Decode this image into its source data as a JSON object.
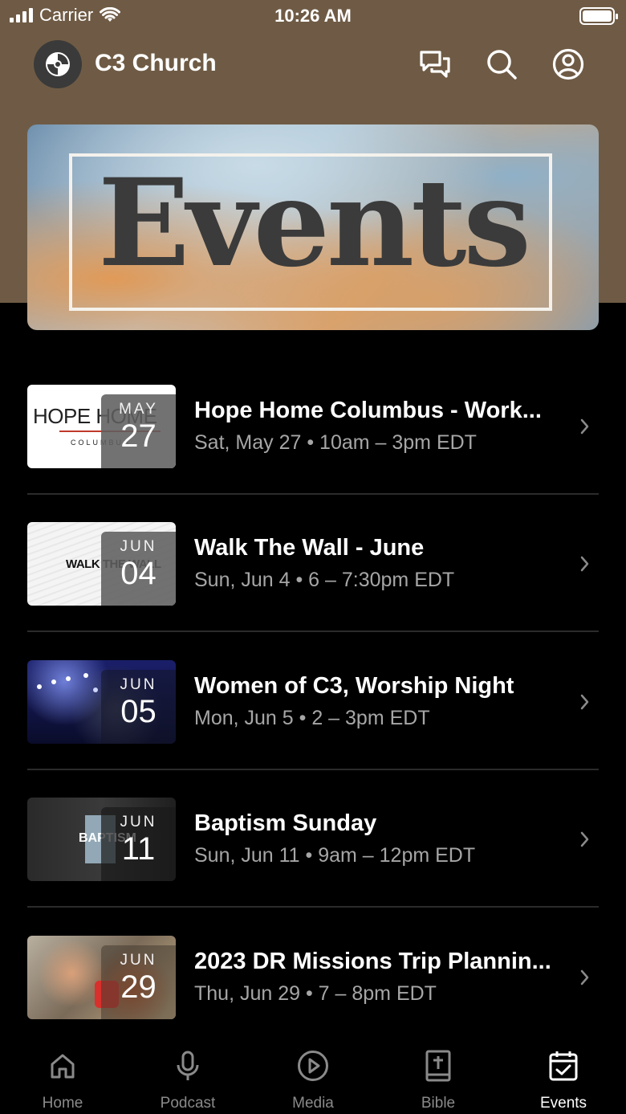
{
  "status_bar": {
    "carrier": "Carrier",
    "time": "10:26 AM"
  },
  "header": {
    "title": "C3 Church"
  },
  "banner": {
    "text": "Events"
  },
  "events": [
    {
      "title": "Hope Home Columbus - Work...",
      "subtitle": "Sat, May 27 • 10am – 3pm EDT",
      "month": "MAY",
      "day": "27",
      "thumb_text": "HOPE HOME",
      "thumb_sub": "COLUMBUS"
    },
    {
      "title": "Walk The Wall - June",
      "subtitle": "Sun, Jun 4 • 6 – 7:30pm EDT",
      "month": "JUN",
      "day": "04",
      "thumb_text": "WALK THE WALL"
    },
    {
      "title": "Women of C3, Worship Night",
      "subtitle": "Mon, Jun 5 • 2 – 3pm EDT",
      "month": "JUN",
      "day": "05"
    },
    {
      "title": "Baptism Sunday",
      "subtitle": "Sun, Jun 11 • 9am – 12pm EDT",
      "month": "JUN",
      "day": "11",
      "thumb_text": "BAPTISM"
    },
    {
      "title": "2023 DR Missions Trip Plannin...",
      "subtitle": "Thu, Jun 29 • 7 – 8pm EDT",
      "month": "JUN",
      "day": "29"
    }
  ],
  "tabs": [
    {
      "label": "Home",
      "icon": "home-icon"
    },
    {
      "label": "Podcast",
      "icon": "microphone-icon"
    },
    {
      "label": "Media",
      "icon": "play-icon"
    },
    {
      "label": "Bible",
      "icon": "bible-icon"
    },
    {
      "label": "Events",
      "icon": "calendar-icon",
      "active": true
    }
  ]
}
